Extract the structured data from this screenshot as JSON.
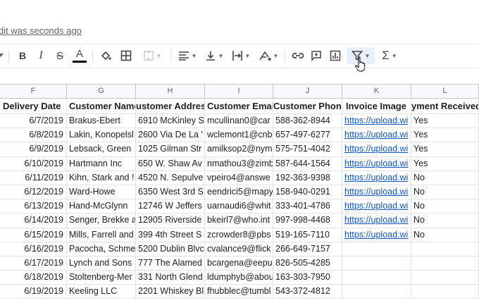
{
  "last_edit": "dit was seconds ago",
  "toolbar": {
    "bold": "B",
    "italic": "I",
    "strike": "S",
    "text_color": "A",
    "link_icon": "link-icon",
    "comment_icon": "comment-icon",
    "chart_icon": "chart-icon",
    "filter_icon": "filter-icon",
    "functions": "Σ"
  },
  "columns": [
    "F",
    "G",
    "H",
    "I",
    "J",
    "K",
    "L"
  ],
  "headers": [
    "Delivery Date",
    "Customer Name",
    "ustomer Addres",
    "Customer Email",
    "Customer Phone",
    "Invoice Image",
    "yment Received"
  ],
  "rows": [
    [
      "6/7/2019",
      "Brakus-Ebert",
      "6910 McKinley S",
      "mcullinan0@car",
      "588-362-8944",
      "https://upload.wi",
      "Yes"
    ],
    [
      "6/8/2019",
      "Lakin, Konopelsl",
      "2600 Via De La '",
      "wclemont1@cnb",
      "657-497-6277",
      "https://upload.wi",
      "Yes"
    ],
    [
      "6/9/2019",
      "Lebsack, Green",
      "1025 Gilman Str",
      "amilksop2@nym",
      "575-751-4042",
      "https://upload.wi",
      "Yes"
    ],
    [
      "6/10/2019",
      "Hartmann Inc",
      "650 W. Shaw Av",
      "nmathou3@zimb",
      "587-644-1564",
      "https://upload.wi",
      "Yes"
    ],
    [
      "6/11/2019",
      "Kihn, Stark and !",
      "4520 N. Sepulve",
      "vpeiro4@answe",
      "192-363-9398",
      "https://upload.wi",
      "No"
    ],
    [
      "6/12/2019",
      "Ward-Howe",
      "6350 West 3rd S",
      "eendrici5@mapy",
      "158-940-0291",
      "https://upload.wi",
      "No"
    ],
    [
      "6/13/2019",
      "Hand-McGlynn",
      "12746 W Jeffers",
      "uarnaudi6@whit",
      "333-401-4786",
      "https://upload.wi",
      "No"
    ],
    [
      "6/14/2019",
      "Senger, Brekke a",
      "12905 Riverside",
      "bkeirl7@who.int",
      "997-998-4468",
      "https://upload.wi",
      "No"
    ],
    [
      "6/15/2019",
      "Mills, Farrell and",
      "399 4th Street S",
      "zcrowder8@pbs",
      "519-165-7110",
      "https://upload.wi",
      "No"
    ],
    [
      "6/16/2019",
      "Pacocha, Schme",
      "5200 Dublin Blvc",
      "cvalance9@flick",
      "266-649-7157",
      "",
      ""
    ],
    [
      "6/17/2019",
      "Lynch and Sons",
      "777 The Alamed",
      "bcargena@eepu",
      "826-505-4285",
      "",
      ""
    ],
    [
      "6/18/2019",
      "Stoltenberg-Mer",
      "331 North Glend",
      "ldumphyb@abou",
      "163-303-7950",
      "",
      ""
    ],
    [
      "6/19/2019",
      "Keeling LLC",
      "2201 Whiskey Bl",
      "fhubblec@tumbl",
      "543-372-4812",
      "",
      ""
    ]
  ],
  "colors": {
    "link": "#1155cc",
    "header_bg": "#f8f9fa",
    "grid": "#e2e3e3"
  }
}
